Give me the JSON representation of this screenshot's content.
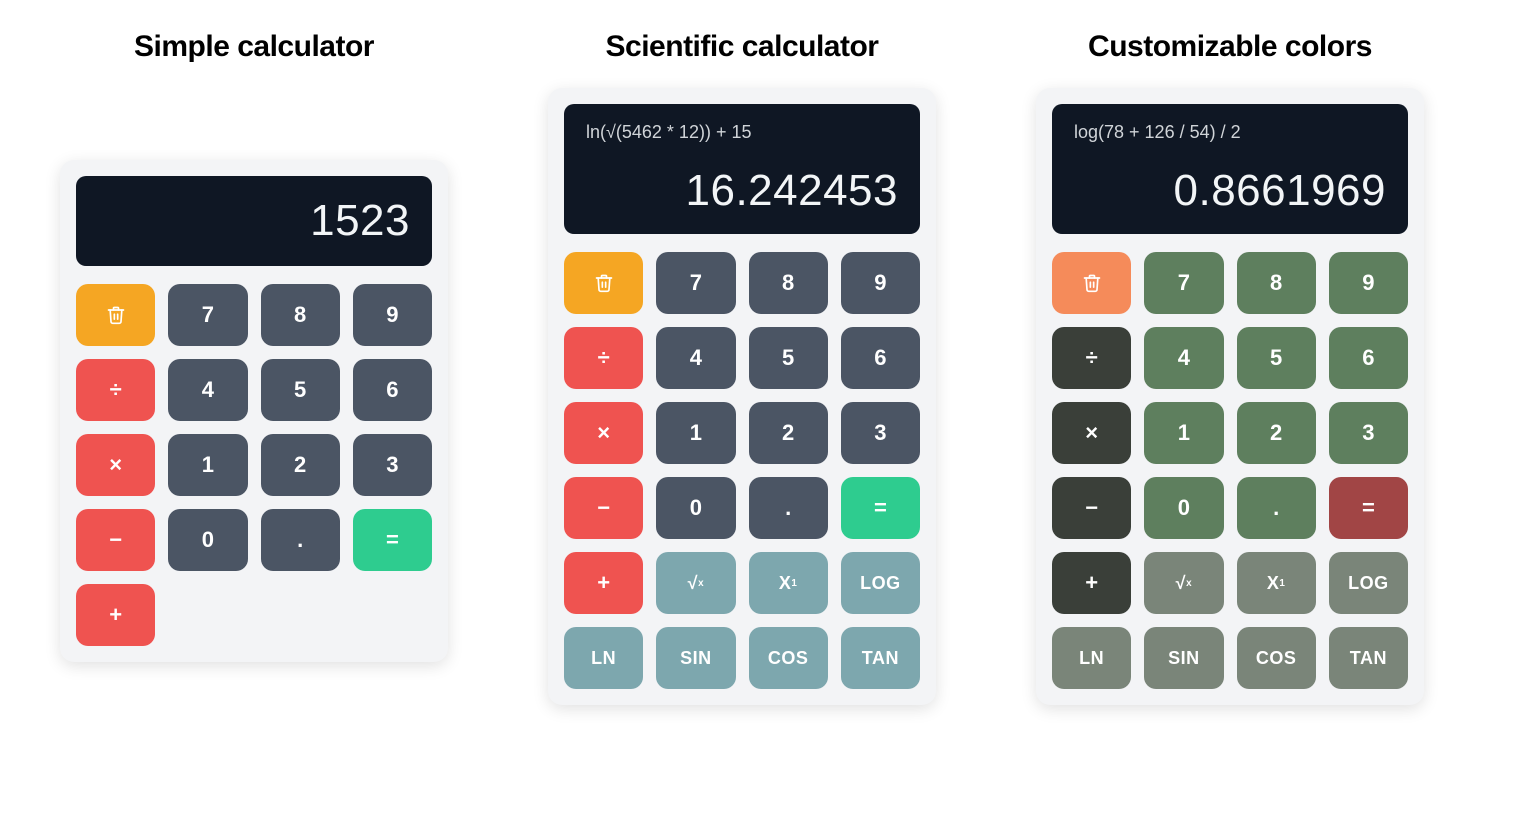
{
  "calculators": [
    {
      "id": "simple",
      "title": "Simple calculator",
      "expression": "",
      "result": "1523",
      "theme": "default",
      "scientific": false
    },
    {
      "id": "scientific",
      "title": "Scientific calculator",
      "expression": "ln(√(5462 * 12)) + 15",
      "result": "16.242453",
      "theme": "default",
      "scientific": true
    },
    {
      "id": "custom",
      "title": "Customizable colors",
      "expression": "log(78 + 126 / 54) / 2",
      "result": "0.8661969",
      "theme": "green",
      "scientific": true
    }
  ],
  "keys": {
    "clear": "trash-icon",
    "num7": "7",
    "num8": "8",
    "num9": "9",
    "divide": "÷",
    "num4": "4",
    "num5": "5",
    "num6": "6",
    "multiply": "×",
    "num1": "1",
    "num2": "2",
    "num3": "3",
    "minus": "−",
    "num0": "0",
    "dot": ".",
    "equals": "=",
    "plus": "+",
    "sqrt": "√x",
    "pow": "X¹",
    "log": "LOG",
    "ln": "LN",
    "sin": "SIN",
    "cos": "COS",
    "tan": "TAN"
  }
}
